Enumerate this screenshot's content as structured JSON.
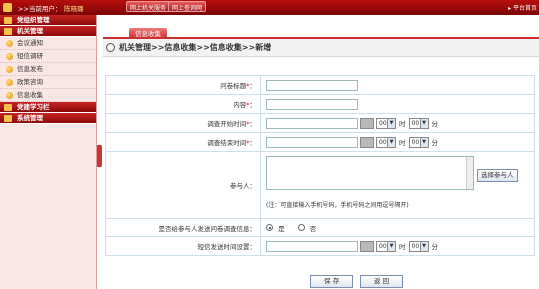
{
  "topbar": {
    "user_prefix": ">>当前用户：",
    "user_name": "陈晓璐",
    "links": [
      "网上机关服务",
      "网上查询网"
    ],
    "platform": "平台首页"
  },
  "sidebar": {
    "sections": [
      {
        "header": "党组织管理"
      },
      {
        "header": "机关管理",
        "items": [
          "会议通知",
          "短信调研",
          "信息发布",
          "政策咨询",
          "信息收集"
        ]
      },
      {
        "header": "党建学习栏"
      },
      {
        "header": "系统管理"
      }
    ]
  },
  "tab": {
    "label": "信息收集"
  },
  "breadcrumb": "机关管理>>信息收集>>信息收集>>新增",
  "form": {
    "title_label": "问卷标题",
    "content_label": "内容",
    "req_mark": "*",
    "colon": "：",
    "start_label": "调查开始时间",
    "end_label": "调查结束时间",
    "participants_label": "参与人：",
    "choose_participants": "选择参与人",
    "hint": "(注：可直接输入手机号码，手机号码之间用逗号隔开)",
    "sms_label": "是否给参与人发送问卷调查信息：",
    "yes": "是",
    "no": "否",
    "sms_time_label": "短信发送时间设置：",
    "hour_value": "00",
    "minute_value": "00",
    "hour_unit": "时",
    "minute_unit": "分"
  },
  "buttons": {
    "save": "保 存",
    "back": "返 回"
  }
}
